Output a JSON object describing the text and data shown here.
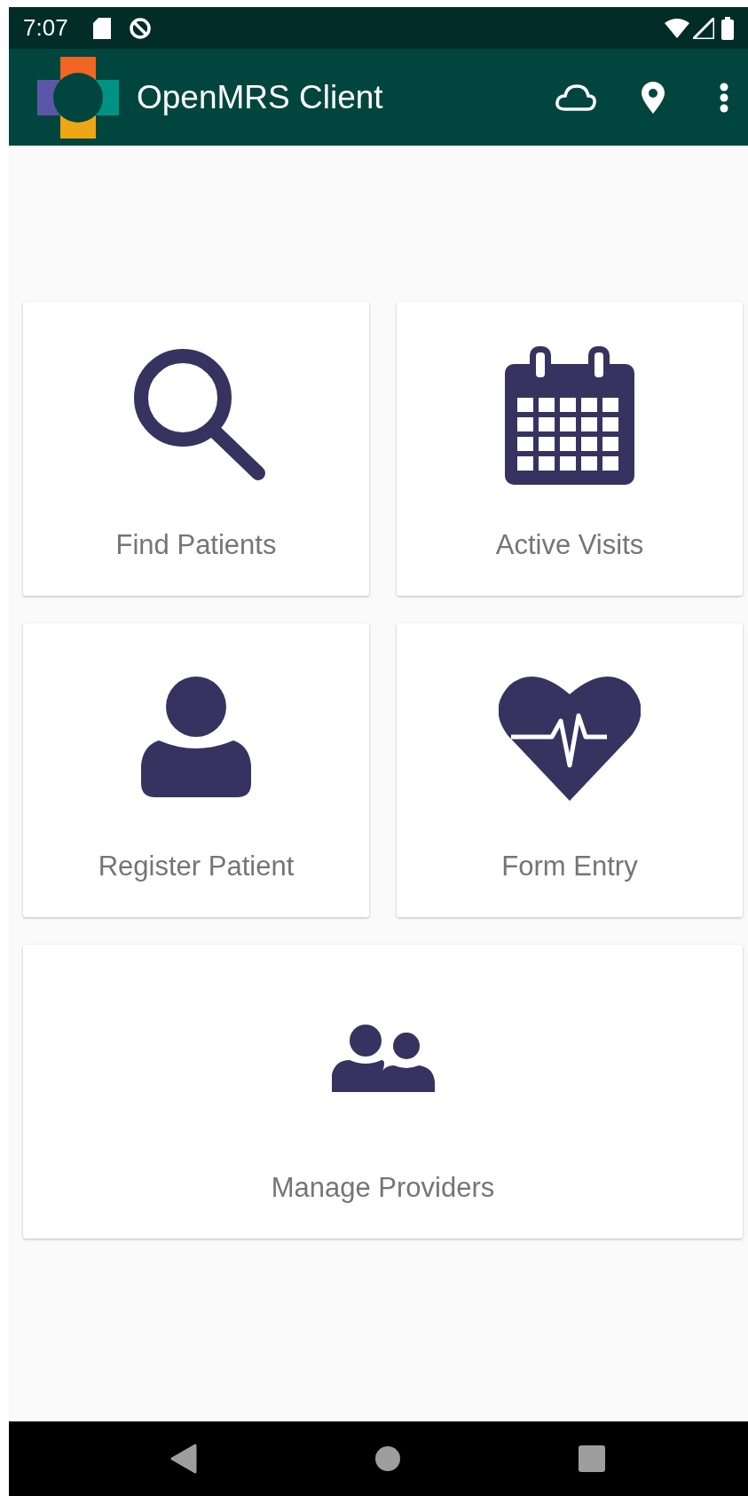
{
  "status_bar": {
    "time": "7:07"
  },
  "app_bar": {
    "title": "OpenMRS Client"
  },
  "tiles": [
    {
      "label": "Find Patients",
      "kind": "search"
    },
    {
      "label": "Active Visits",
      "kind": "calendar"
    },
    {
      "label": "Register Patient",
      "kind": "person"
    },
    {
      "label": "Form Entry",
      "kind": "heart"
    },
    {
      "label": "Manage Providers",
      "kind": "people"
    }
  ]
}
